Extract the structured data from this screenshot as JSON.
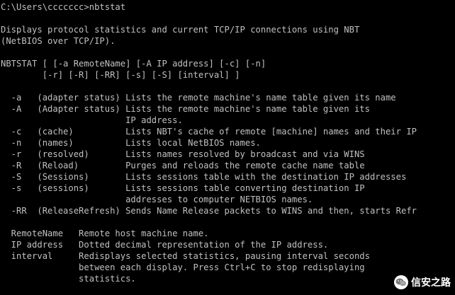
{
  "console": {
    "lines": [
      "C:\\Users\\ccccccc>nbtstat",
      "",
      "Displays protocol statistics and current TCP/IP connections using NBT",
      "(NetBIOS over TCP/IP).",
      "",
      "NBTSTAT [ [-a RemoteName] [-A IP address] [-c] [-n]",
      "        [-r] [-R] [-RR] [-s] [-S] [interval] ]",
      "",
      "  -a   (adapter status) Lists the remote machine's name table given its name",
      "  -A   (Adapter status) Lists the remote machine's name table given its",
      "                        IP address.",
      "  -c   (cache)          Lists NBT's cache of remote [machine] names and their IP",
      "  -n   (names)          Lists local NetBIOS names.",
      "  -r   (resolved)       Lists names resolved by broadcast and via WINS",
      "  -R   (Reload)         Purges and reloads the remote cache name table",
      "  -S   (Sessions)       Lists sessions table with the destination IP addresses",
      "  -s   (sessions)       Lists sessions table converting destination IP",
      "                        addresses to computer NETBIOS names.",
      "  -RR  (ReleaseRefresh) Sends Name Release packets to WINS and then, starts Refr",
      "",
      "  RemoteName   Remote host machine name.",
      "  IP address   Dotted decimal representation of the IP address.",
      "  interval     Redisplays selected statistics, pausing interval seconds",
      "               between each display. Press Ctrl+C to stop redisplaying",
      "               statistics."
    ]
  },
  "watermark": {
    "text": "信安之路",
    "icon": "wechat-icon"
  },
  "colors": {
    "background": "#000000",
    "text": "#c0c0c0"
  }
}
